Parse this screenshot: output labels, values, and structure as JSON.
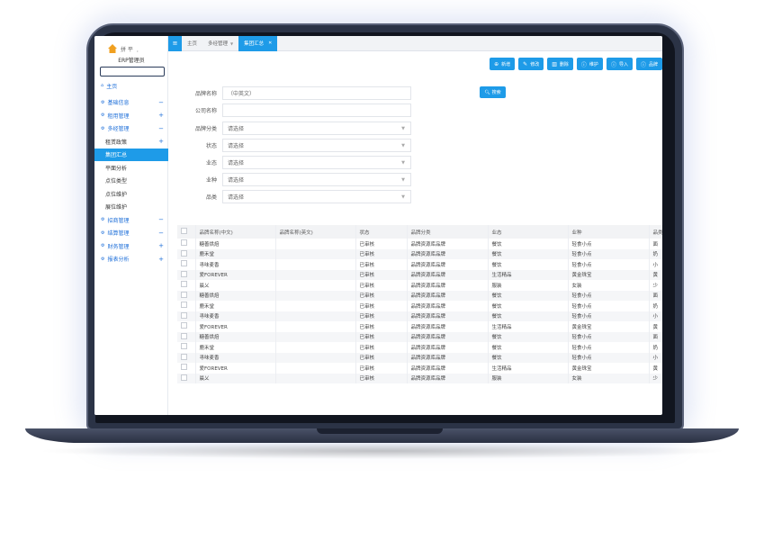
{
  "brand": {
    "logo_text": "拼 平 ﹐",
    "user": "ERP管理员"
  },
  "sidebar": {
    "items": [
      {
        "label": "主页",
        "icon": "home-icon",
        "sign": ""
      },
      {
        "label": "基础信息",
        "icon": "gear-icon",
        "sign": "−"
      },
      {
        "label": "租用管理",
        "icon": "gear-icon",
        "sign": "+"
      },
      {
        "label": "多经管理",
        "icon": "gear-icon",
        "sign": "−"
      },
      {
        "label": "租赁政策",
        "icon": "",
        "sign": "+"
      },
      {
        "label": "集团汇总",
        "icon": "",
        "sign": ""
      },
      {
        "label": "平面分析",
        "icon": "",
        "sign": ""
      },
      {
        "label": "点位类型",
        "icon": "",
        "sign": ""
      },
      {
        "label": "点位维护",
        "icon": "",
        "sign": ""
      },
      {
        "label": "展位维护",
        "icon": "",
        "sign": ""
      },
      {
        "label": "招商管理",
        "icon": "gear-icon",
        "sign": "−"
      },
      {
        "label": "结算管理",
        "icon": "gear-icon",
        "sign": "−"
      },
      {
        "label": "财务管理",
        "icon": "gear-icon",
        "sign": "+"
      },
      {
        "label": "报表分析",
        "icon": "gear-icon",
        "sign": "+"
      }
    ]
  },
  "topbar": {
    "tabs": [
      {
        "label": "主页"
      },
      {
        "label": "多经管理"
      },
      {
        "label": "集团汇总"
      }
    ]
  },
  "toolbar": {
    "buttons": [
      {
        "label": "新增",
        "icon": "plus-icon"
      },
      {
        "label": "修改",
        "icon": "edit-icon"
      },
      {
        "label": "删除",
        "icon": "trash-icon"
      },
      {
        "label": "维护",
        "icon": "info-icon"
      },
      {
        "label": "导入",
        "icon": "import-icon"
      },
      {
        "label": "品牌",
        "icon": "info-icon"
      }
    ]
  },
  "filters": {
    "search_label": "搜索",
    "fields": [
      {
        "label": "品牌名称",
        "value": "（中英文）"
      },
      {
        "label": "公司名称",
        "value": ""
      },
      {
        "label": "品牌分类",
        "value": "请选择"
      },
      {
        "label": "状态",
        "value": "请选择"
      },
      {
        "label": "业态",
        "value": "请选择"
      },
      {
        "label": "业种",
        "value": "请选择"
      },
      {
        "label": "品类",
        "value": "请选择"
      }
    ]
  },
  "table": {
    "headers": [
      "品牌名称(中文)",
      "品牌名称(英文)",
      "状态",
      "品牌分类",
      "业态",
      "业种",
      "品类"
    ],
    "rows": [
      [
        "糖善烘焙",
        "",
        "已审核",
        "品牌资源库品牌",
        "餐饮",
        "轻食小点",
        "面"
      ],
      [
        "鹿禾堂",
        "",
        "已审核",
        "品牌资源库品牌",
        "餐饮",
        "轻食小点",
        "奶"
      ],
      [
        "寻味麦香",
        "",
        "已审核",
        "品牌资源库品牌",
        "餐饮",
        "轻食小点",
        "小"
      ],
      [
        "爱FOREVER",
        "",
        "已审核",
        "品牌资源库品牌",
        "生活精品",
        "黄金珠宝",
        "黄"
      ],
      [
        "晨乂",
        "",
        "已审核",
        "品牌资源库品牌",
        "服装",
        "女装",
        "少"
      ],
      [
        "糖善烘焙",
        "",
        "已审核",
        "品牌资源库品牌",
        "餐饮",
        "轻食小点",
        "面"
      ],
      [
        "鹿禾堂",
        "",
        "已审核",
        "品牌资源库品牌",
        "餐饮",
        "轻食小点",
        "奶"
      ],
      [
        "寻味麦香",
        "",
        "已审核",
        "品牌资源库品牌",
        "餐饮",
        "轻食小点",
        "小"
      ],
      [
        "爱FOREVER",
        "",
        "已审核",
        "品牌资源库品牌",
        "生活精品",
        "黄金珠宝",
        "黄"
      ],
      [
        "糖善烘焙",
        "",
        "已审核",
        "品牌资源库品牌",
        "餐饮",
        "轻食小点",
        "面"
      ],
      [
        "鹿禾堂",
        "",
        "已审核",
        "品牌资源库品牌",
        "餐饮",
        "轻食小点",
        "奶"
      ],
      [
        "寻味麦香",
        "",
        "已审核",
        "品牌资源库品牌",
        "餐饮",
        "轻食小点",
        "小"
      ],
      [
        "爱FOREVER",
        "",
        "已审核",
        "品牌资源库品牌",
        "生活精品",
        "黄金珠宝",
        "黄"
      ],
      [
        "晨乂",
        "",
        "已审核",
        "品牌资源库品牌",
        "服装",
        "女装",
        "少"
      ]
    ]
  }
}
